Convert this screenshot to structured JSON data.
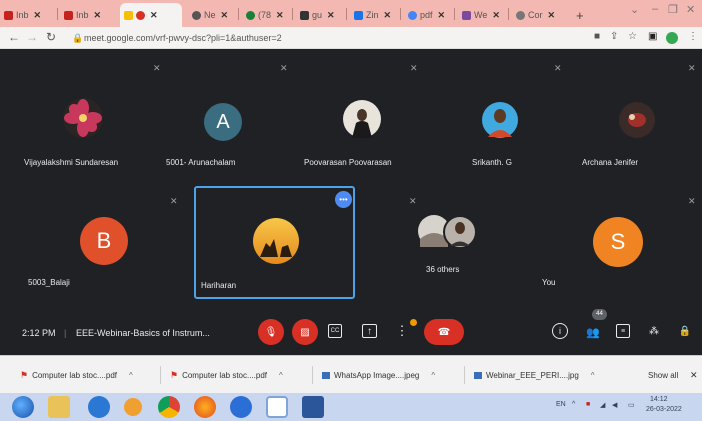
{
  "browser": {
    "tabs": [
      {
        "label": "Inb",
        "color": "#c5221f"
      },
      {
        "label": "Inb",
        "color": "#c5221f"
      },
      {
        "label": "",
        "color": "#fbbc04",
        "active": true
      },
      {
        "label": "Ne",
        "color": "#555555"
      },
      {
        "label": "(78",
        "color": "#188038"
      },
      {
        "label": "gu",
        "color": "#333333"
      },
      {
        "label": "Zin",
        "color": "#1a73e8"
      },
      {
        "label": "pdf",
        "color": "#4285f4"
      },
      {
        "label": "We",
        "color": "#7b4a9e"
      },
      {
        "label": "Cor",
        "color": "#777777"
      }
    ],
    "new_tab": "+",
    "url": "meet.google.com/vrf-pwvy-dsc?pli=1&authuser=2"
  },
  "meet": {
    "participants_top": [
      {
        "name": "Vijayalakshmi Sundaresan",
        "avatar": "flower-photo"
      },
      {
        "name": "5001- Arunachalam",
        "initial": "A",
        "color": "#3a6d80"
      },
      {
        "name": "Poovarasan Poovarasan",
        "avatar": "person-photo"
      },
      {
        "name": "Srikanth. G",
        "avatar": "person-photo"
      },
      {
        "name": "Archana Jenifer",
        "avatar": "photo"
      }
    ],
    "participants_bottom": [
      {
        "name": "5003_Balaji",
        "initial": "B",
        "color": "#e0502b"
      },
      {
        "name": "Hariharan",
        "avatar": "sunset-photo"
      },
      {
        "name": "36 others"
      },
      {
        "name": "You",
        "initial": "S",
        "color": "#f08422"
      }
    ],
    "time": "2:12 PM",
    "meeting_title": "EEE-Webinar-Basics of Instrum...",
    "people_count": "44",
    "colors": {
      "end_call": "#d93025",
      "highlight": "#4da3e8"
    }
  },
  "downloads": {
    "items": [
      {
        "label": "Computer lab stoc....pdf",
        "icon": "pdf-icon"
      },
      {
        "label": "Computer lab stoc....pdf",
        "icon": "pdf-icon"
      },
      {
        "label": "WhatsApp Image....jpeg",
        "icon": "image-icon"
      },
      {
        "label": "Webinar_EEE_PERI....jpg",
        "icon": "image-icon"
      }
    ],
    "show_all": "Show all"
  },
  "taskbar": {
    "lang": "EN",
    "time": "14:12",
    "date": "26-03-2022"
  }
}
